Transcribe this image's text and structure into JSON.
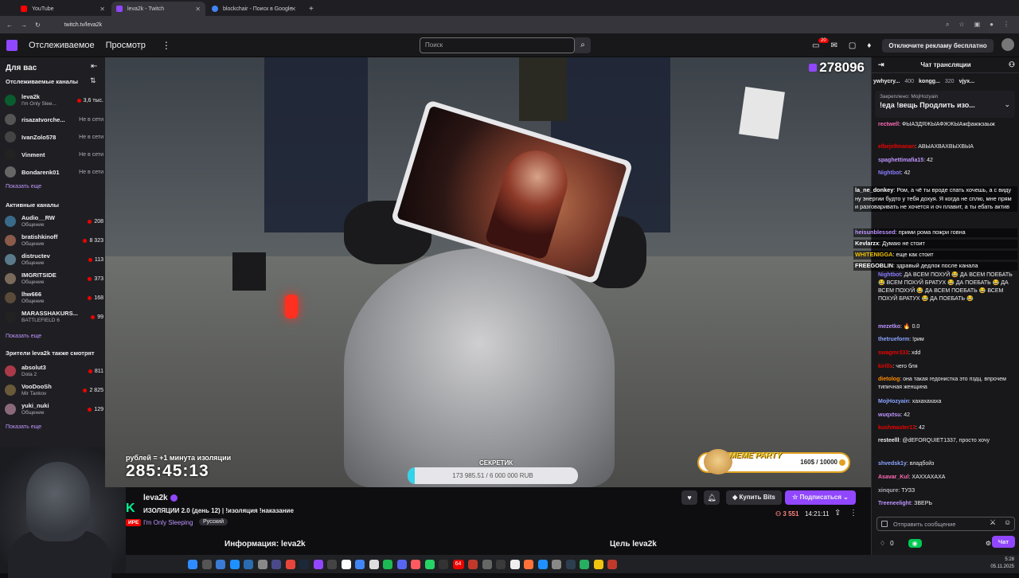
{
  "browser": {
    "tabs": [
      {
        "title": "YouTube",
        "color": "#ff0000",
        "active": false
      },
      {
        "title": "leva2k - Twitch",
        "color": "#9147ff",
        "active": true
      },
      {
        "title": "blockchair - Поиск в Google",
        "color": "#4285f4",
        "active": false
      }
    ],
    "url": "twitch.tv/leva2k"
  },
  "nav": {
    "following": "Отслеживаемое",
    "browse": "Просмотр",
    "search_placeholder": "Поиск",
    "notif_count": "20",
    "ad_free": "Отключите рекламу бесплатно"
  },
  "sidebar": {
    "for_you": "Для вас",
    "followed_header": "Отслеживаемые каналы",
    "followed": [
      {
        "name": "leva2k",
        "sub": "I'm Only Slee...",
        "viewers": "3,6 тыс.",
        "live": true
      },
      {
        "name": "risazatvorche...",
        "sub": "",
        "viewers": "Не в сети",
        "live": false
      },
      {
        "name": "IvanZolo578",
        "sub": "",
        "viewers": "Не в сети",
        "live": false
      },
      {
        "name": "Vinment",
        "sub": "",
        "viewers": "Не в сети",
        "live": false
      },
      {
        "name": "Bondarenk01",
        "sub": "",
        "viewers": "Не в сети",
        "live": false
      }
    ],
    "show_more": "Показать еще",
    "active_header": "Активные каналы",
    "active": [
      {
        "name": "Audio__RW",
        "sub": "Общение",
        "viewers": "208"
      },
      {
        "name": "bratishkinoff",
        "sub": "Общение",
        "viewers": "8 323"
      },
      {
        "name": "distructev",
        "sub": "Общение",
        "viewers": "113"
      },
      {
        "name": "IMGRITSIDE",
        "sub": "Общение",
        "viewers": "373"
      },
      {
        "name": "lhw666",
        "sub": "Общение",
        "viewers": "168"
      },
      {
        "name": "MARASSHAKURS...",
        "sub": "BATTLEFIELD 6",
        "viewers": "99"
      }
    ],
    "also_header": "Зрители leva2k также смотрят",
    "also": [
      {
        "name": "absolut3",
        "sub": "Dota 2",
        "viewers": "811"
      },
      {
        "name": "VooDooSh",
        "sub": "Mir Tankov",
        "viewers": "2 825"
      },
      {
        "name": "yuki_nuki",
        "sub": "Общение",
        "viewers": "129"
      }
    ]
  },
  "overlay": {
    "view_counter": "278096",
    "timer_label": "рублей = +1 минута изоляции",
    "timer": "285:45:13",
    "goal_label": "СЕКРЕТИК",
    "goal_text": "173 985.51 / 6 000 000 RUB",
    "goal_fraction": 0.029,
    "meme_title": "MEME PARTY",
    "meme_count": "160$ / 10000"
  },
  "stream": {
    "channel": "leva2k",
    "title": "ИЗОЛЯЦИИ 2.0 (день 12) | !изоляция !наказание",
    "live_label": "ИРЕ",
    "category": "I'm Only Sleeping",
    "language": "Русский",
    "bits_label": "Купить Bits",
    "subscribe_label": "Подписаться",
    "viewers": "3 551",
    "uptime": "14:21:11",
    "about": "Информация: leva2k",
    "goal_header": "Цель leva2k"
  },
  "chat": {
    "header": "Чат трансляции",
    "gifters": [
      {
        "name": "ywhycry...",
        "count": "400"
      },
      {
        "name": "kongg...",
        "count": "320"
      },
      {
        "name": "vjyx...",
        "count": ""
      }
    ],
    "pinned_label": "Закреплено: MojHozyain",
    "pinned_text": "!еда !вещь Продлить изо...",
    "messages": [
      {
        "user": "rectwell",
        "color": "#ff69b4",
        "text": "ФЫАЗДЯЖЫАФЖЖЫАжфажжзаыж"
      },
      {
        "user": "elbejellmanan",
        "color": "#eb0400",
        "text": "АВЫАХВАХВЫХВЫА"
      },
      {
        "user": "spaghettimafia15",
        "color": "#bf94ff",
        "text": "42"
      },
      {
        "user": "Nightbot",
        "color": "#8a7cff",
        "text": "42"
      },
      {
        "user": "Nightbot",
        "color": "#8a7cff",
        "text": "ДА ВСЕМ ПОХУЙ 😂 ДА ВСЕМ ПОЕБАТЬ 😂 ВСЕМ ПОХУЙ БРАТУХ 😂 ДА ПОЕБАТЬ 😂 ДА ВСЕМ ПОХУЙ 😂 ДА ВСЕМ ПОЕБАТЬ 😂 ВСЕМ ПОХУЙ БРАТУХ 😂 ДА ПОЕБАТЬ 😂"
      },
      {
        "user": "mezetko",
        "color": "#bf94ff",
        "text": "🔥 0.0"
      },
      {
        "user": "thetrueform",
        "color": "#8aa4ff",
        "text": "!рим"
      },
      {
        "user": "swagmr333",
        "color": "#eb0400",
        "text": "xdd"
      },
      {
        "user": "kirills",
        "color": "#eb0400",
        "text": "чего бля"
      },
      {
        "user": "dietolog",
        "color": "#ff8c00",
        "text": "она такая гедонистка это пздц. впрочем типичная женщина"
      },
      {
        "user": "MojHozyain",
        "color": "#8aa4ff",
        "text": "хахахахаха"
      },
      {
        "user": "wuqxtsu",
        "color": "#bf94ff",
        "text": "42"
      },
      {
        "user": "kushmaster13",
        "color": "#eb0400",
        "text": "42"
      },
      {
        "user": "resteelll",
        "color": "#efeff1",
        "text": "@dEFORQUIET1337, просто хочу"
      },
      {
        "user": "shvedsk1y",
        "color": "#8aa4ff",
        "text": "владбойз"
      },
      {
        "user": "Asavar_Kul",
        "color": "#ff69b4",
        "text": "ХАХХАХАХА"
      },
      {
        "user": "xinqure",
        "color": "#adadb8",
        "text": "ТУЗЗ"
      },
      {
        "user": "Treeneelight",
        "color": "#bf94ff",
        "text": "ЗВЕРЬ"
      }
    ],
    "overlay_messages": [
      {
        "user": "la_ne_donkey",
        "color": "#efeff1",
        "text": "Ром, а чё ты вроде спать хочешь, а с виду ну энергии будто у тебя дохуя. Я когда не сплю, мне прям и разговаривать не хочется и оч плавит, а ты ебать актив"
      },
      {
        "user": "heisunblessed",
        "color": "#bf94ff",
        "text": "прими рома пожри говна"
      },
      {
        "user": "Kevlarzx",
        "color": "#efeff1",
        "text": "Думаю не стоит"
      },
      {
        "user": "WHITENIGGA",
        "color": "#f0c000",
        "text": "еще как стоит"
      },
      {
        "user": "FREEGOBLIN",
        "color": "#efeff1",
        "text": "здравый дедлок после канала"
      }
    ],
    "input_placeholder": "Отправить сообщение",
    "points": "0",
    "chat_button": "Чат"
  },
  "taskbar": {
    "time": "5:28",
    "date": "05.11.2025",
    "badge": "64"
  }
}
